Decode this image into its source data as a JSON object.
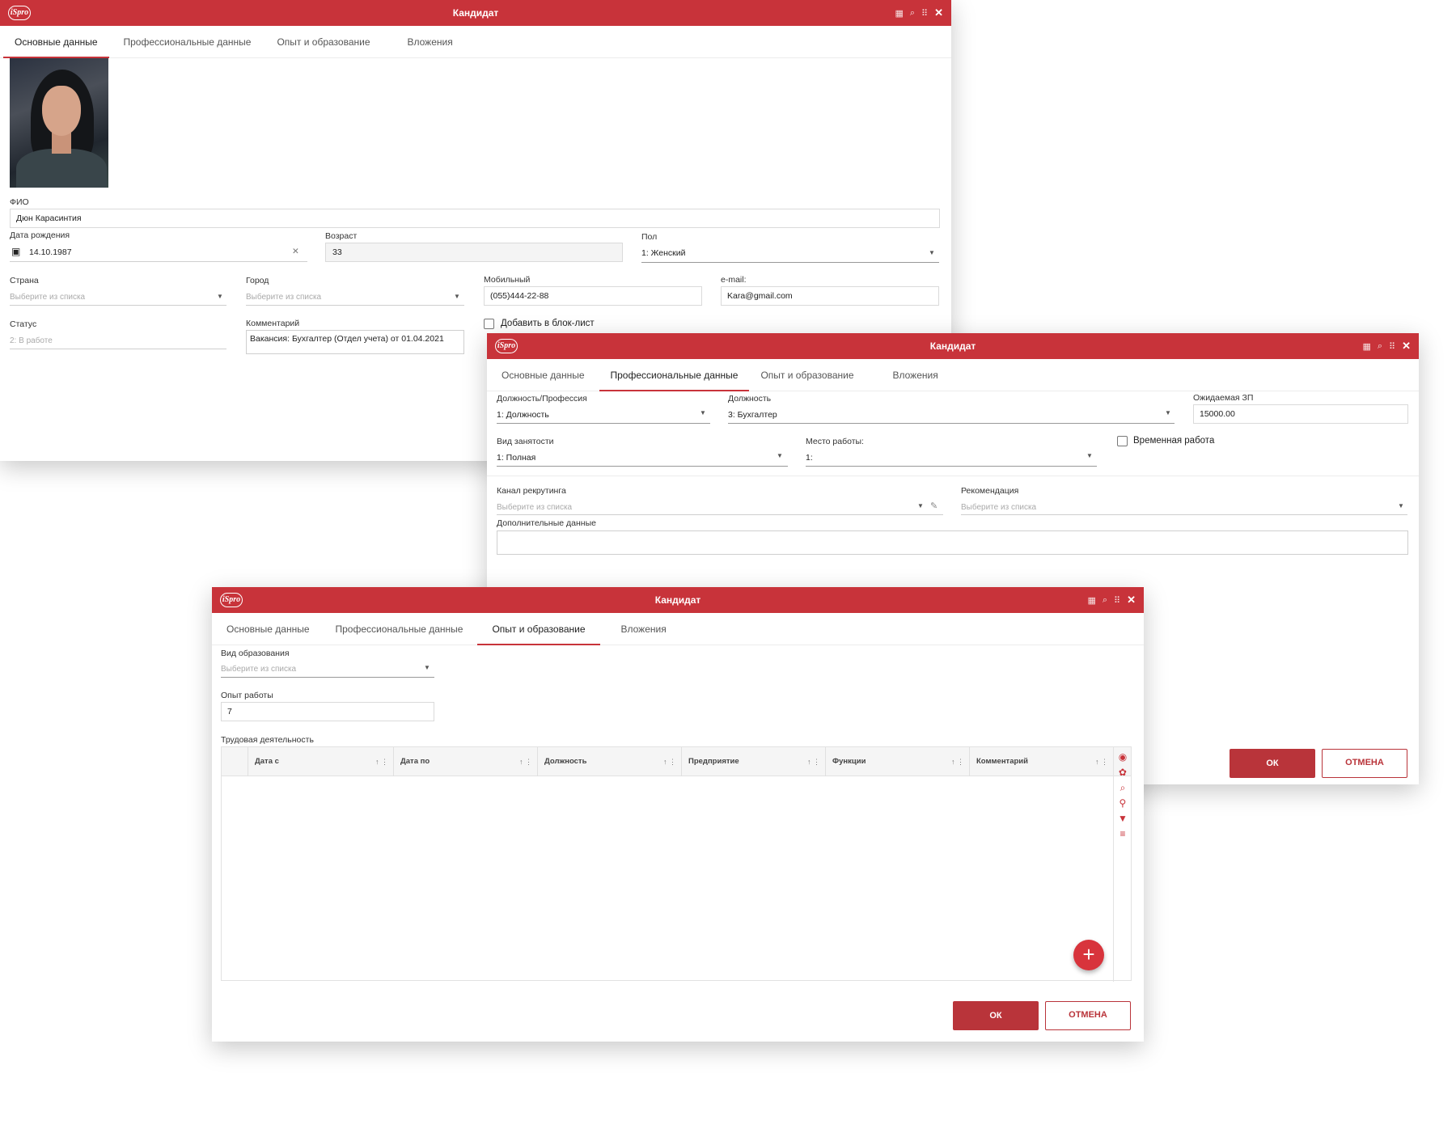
{
  "windows": [
    {
      "title": "Кандидат",
      "tabs": [
        "Основные данные",
        "Профессиональные данные",
        "Опыт и образование",
        "Вложения"
      ],
      "fio": {
        "label": "ФИО",
        "value": "Дюн Карасинтия"
      },
      "birth": {
        "label": "Дата рождения",
        "value": "14.10.1987",
        "clear": "✕"
      },
      "age": {
        "label": "Возраст",
        "value": "33"
      },
      "gender": {
        "label": "Пол",
        "value": "1: Женский"
      },
      "country": {
        "label": "Страна",
        "placeholder": "Выберите из списка"
      },
      "city": {
        "label": "Город",
        "placeholder": "Выберите из списка"
      },
      "mobile": {
        "label": "Мобильный",
        "value": "(055)444-22-88"
      },
      "email": {
        "label": "e-mail:",
        "value": "Kara@gmail.com"
      },
      "status": {
        "label": "Статус",
        "value": "2: В работе"
      },
      "comment": {
        "label": "Комментарий",
        "value": "Вакансия: Бухгалтер (Отдел учета) от 01.04.2021"
      },
      "blocklist": {
        "label": "Добавить в блок-лист",
        "checked": false
      }
    },
    {
      "title": "Кандидат",
      "tabs": [
        "Основные данные",
        "Профессиональные данные",
        "Опыт и образование",
        "Вложения"
      ],
      "profession": {
        "label": "Должность/Профессия",
        "value": "1: Должность"
      },
      "position": {
        "label": "Должность",
        "value": "3: Бухгалтер"
      },
      "salary": {
        "label": "Ожидаемая ЗП",
        "value": "15000.00"
      },
      "employment": {
        "label": "Вид занятости",
        "value": "1: Полная"
      },
      "workplace": {
        "label": "Место работы:",
        "value": "1:"
      },
      "temporary": {
        "label": "Временная работа",
        "checked": false
      },
      "channel": {
        "label": "Канал рекрутинга",
        "placeholder": "Выберите из списка"
      },
      "recommendation": {
        "label": "Рекомендация",
        "placeholder": "Выберите из списка"
      },
      "extra": {
        "label": "Дополнительные данные",
        "value": ""
      },
      "ok": "ОК",
      "cancel": "ОТМЕНА"
    },
    {
      "title": "Кандидат",
      "tabs": [
        "Основные данные",
        "Профессиональные данные",
        "Опыт и образование",
        "Вложения"
      ],
      "education": {
        "label": "Вид образования",
        "placeholder": "Выберите из списка"
      },
      "experience": {
        "label": "Опыт работы",
        "value": "7"
      },
      "work_history": {
        "label": "Трудовая деятельность",
        "columns": [
          "Дата с",
          "Дата по",
          "Должность",
          "Предприятие",
          "Функции",
          "Комментарий"
        ]
      },
      "ok": "ОК",
      "cancel": "ОТМЕНА"
    }
  ],
  "logo_text": "iSpro",
  "icons": {
    "grid": "grid-icon",
    "search": "search-icon",
    "menu": "more-icon",
    "close": "close-icon",
    "calendar": "calendar-icon",
    "eye": "eye-icon",
    "palette": "palette-icon",
    "pin": "pin-icon",
    "filter": "filter-icon",
    "sort": "sort-icon",
    "add": "add-icon"
  },
  "colors": {
    "accent": "#c8333a",
    "button": "#b9343a"
  }
}
